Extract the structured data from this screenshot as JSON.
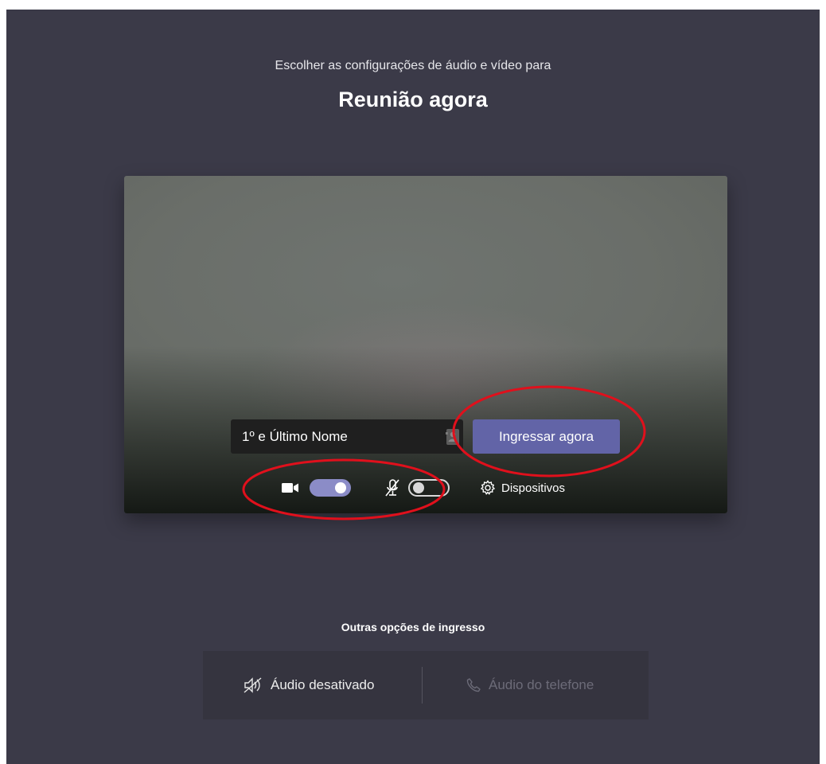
{
  "header": {
    "subtitle": "Escolher as configurações de áudio e vídeo para",
    "meeting_title": "Reunião agora"
  },
  "preview": {
    "name_input": {
      "placeholder": "1º e Último Nome",
      "value": ""
    },
    "join_button_label": "Ingressar agora",
    "camera_toggle": {
      "state": "on",
      "icon": "video-camera-icon"
    },
    "mic_toggle": {
      "state": "off",
      "icon": "mic-off-icon"
    },
    "devices_label": "Dispositivos",
    "devices_icon": "gear-icon"
  },
  "other_options": {
    "title": "Outras opções de ingresso",
    "audio_off_label": "Áudio desativado",
    "audio_off_icon": "speaker-off-icon",
    "phone_audio_label": "Áudio do telefone",
    "phone_audio_icon": "phone-icon"
  },
  "colors": {
    "background": "#3b3a48",
    "accent": "#6264a7",
    "toggle_on": "#8b8cc7",
    "annotation": "#e0101c"
  }
}
